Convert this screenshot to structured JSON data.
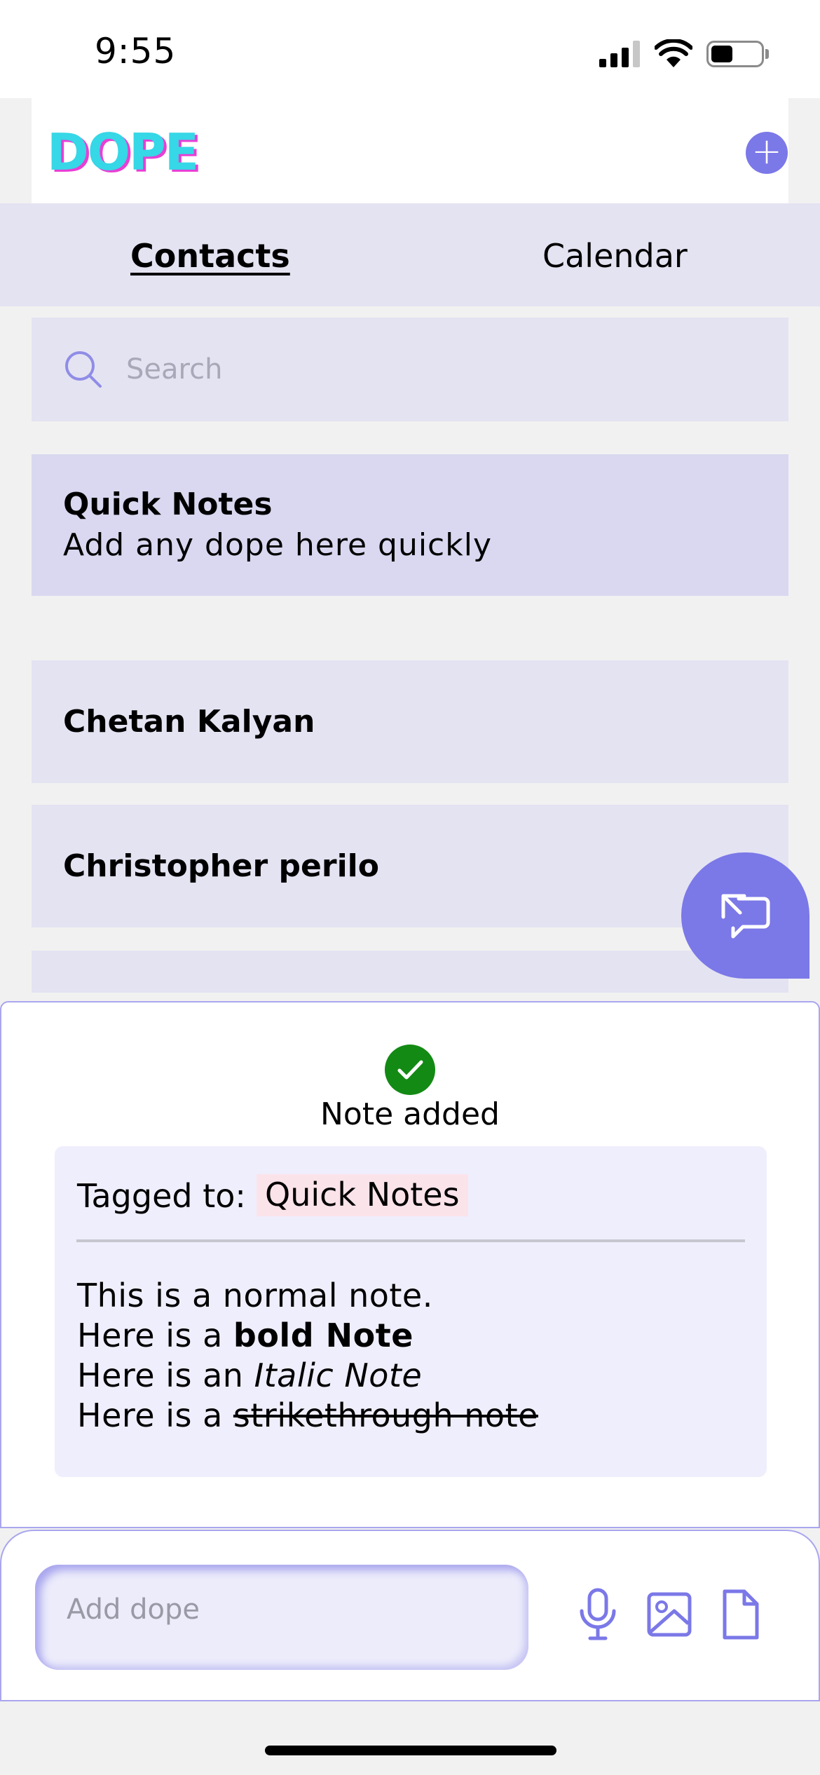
{
  "status_bar": {
    "time": "9:55"
  },
  "header": {
    "logo": "DOPE",
    "add_button_icon": "plus-icon"
  },
  "tabs": [
    {
      "label": "Contacts",
      "active": true
    },
    {
      "label": "Calendar",
      "active": false
    }
  ],
  "search": {
    "placeholder": "Search",
    "value": ""
  },
  "quick_notes": {
    "title": "Quick Notes",
    "subtitle": "Add any dope here quickly"
  },
  "contacts": [
    {
      "name": "Chetan Kalyan"
    },
    {
      "name": "Christopher perilo"
    }
  ],
  "sheet": {
    "status": "Note added",
    "tag_label": "Tagged to:",
    "tag": "Quick Notes",
    "lines": {
      "line1": "This is a normal note.",
      "line2_prefix": "Here is a ",
      "line2_bold": "bold Note",
      "line3_prefix": "Here is an ",
      "line3_italic": "Italic Note",
      "line4_prefix": "Here is a ",
      "line4_strike": "strikethrough note"
    }
  },
  "composer": {
    "placeholder": "Add dope",
    "value": ""
  },
  "colors": {
    "accent": "#7b78e8",
    "panel": "#e4e3f2",
    "quick_notes_bg": "#d9d8f0",
    "success": "#138a14",
    "tag_bg": "#fbe3ea",
    "logo_primary": "#36d7e6",
    "logo_shadow": "#e83fd5"
  }
}
